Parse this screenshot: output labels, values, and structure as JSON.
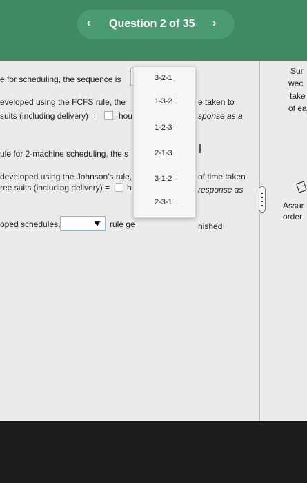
{
  "nav": {
    "prev_icon": "‹",
    "title": "Question 2 of 35",
    "next_icon": "›"
  },
  "question": {
    "line1": "e for scheduling, the sequence is",
    "line2a": "eveloped using the FCFS rule, the",
    "line2b_pre": "suits (including delivery) =",
    "line2b_post": "hou",
    "line3": "ule for 2-machine scheduling, the s",
    "line4a": "developed using the Johnson's rule,",
    "line4b_pre": "ree suits (including delivery) =",
    "line4b_post": "h",
    "line5_pre": "oped schedules,",
    "line5_post": "rule ge",
    "mid1a": "e taken to",
    "mid1b": "sponse as a",
    "mid2a": "of time taken",
    "mid2b": "response as",
    "mid3": "nished"
  },
  "right_panel": {
    "line1": "Sur",
    "line2": "wec",
    "line3": "take",
    "line4": "of ea",
    "line5": "Assur",
    "line6": "order"
  },
  "dropdown_menu": {
    "options": [
      "3-2-1",
      "1-3-2",
      "1-2-3",
      "2-1-3",
      "3-1-2",
      "2-3-1"
    ]
  }
}
